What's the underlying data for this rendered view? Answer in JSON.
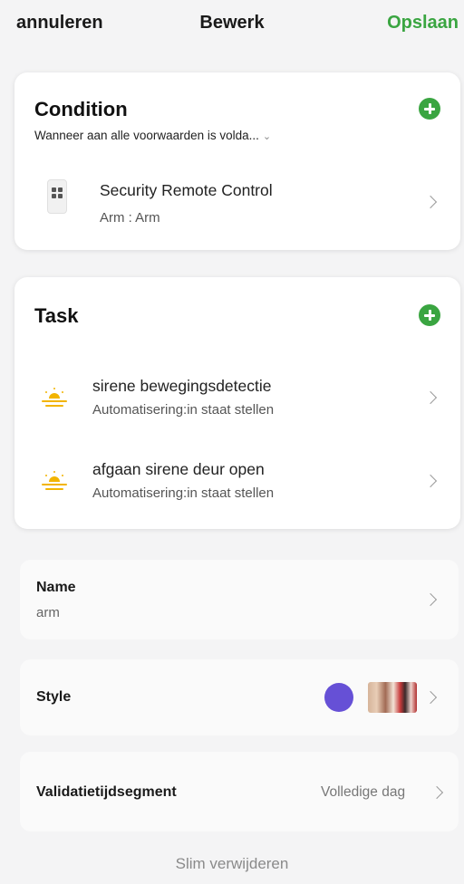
{
  "topbar": {
    "cancel_label": "annuleren",
    "title": "Bewerk",
    "save_label": "Opslaan"
  },
  "condition": {
    "title": "Condition",
    "match_mode": "Wanneer aan alle voorwaarden is volda...",
    "items": [
      {
        "icon": "remote-control-icon",
        "label": "Security Remote Control",
        "detail": "Arm : Arm"
      }
    ]
  },
  "task": {
    "title": "Task",
    "items": [
      {
        "icon": "sunrise-icon",
        "label": "sirene bewegingsdetectie",
        "detail": "Automatisering:in staat stellen"
      },
      {
        "icon": "sunrise-icon",
        "label": "afgaan sirene deur open",
        "detail": "Automatisering:in staat stellen"
      }
    ]
  },
  "settings": {
    "name_label": "Name",
    "name_value": "arm",
    "style_label": "Style",
    "style_color": "#6650d6",
    "validation_label": "Validatietijdsegment",
    "validation_value": "Volledige dag"
  },
  "footer": {
    "delete_label": "Slim verwijderen"
  },
  "colors": {
    "accent": "#3aa541",
    "sun": "#f2b400"
  }
}
